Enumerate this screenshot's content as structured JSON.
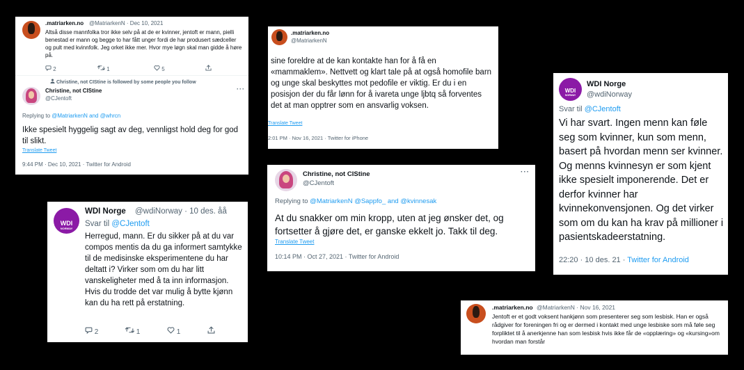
{
  "card1": {
    "name": ".matriarken.no",
    "handle_date": "@MatriarkenN · Dec 10, 2021",
    "text": "Altså disse mannfolka tror ikke selv på at de er kvinner, jentoft er mann, pielli benestad er mann og begge to har fått unger fordi de har produsert sædceller og pult med kvinnfolk. Jeg orket ikke mer. Hvor mye løgn skal man gidde å høre på.",
    "reply_count": "2",
    "retweet_count": "1",
    "like_count": "5",
    "follow_note": "Christine, not CIStine is followed by some people you follow",
    "reply_name": "Christine, not CIStine",
    "reply_handle": "@CJentoft",
    "replying_prefix": "Replying to ",
    "replying_to": "@MatriarkenN and @whrcn",
    "reply_text": "Ikke spesielt hyggelig sagt av deg, vennligst hold deg for god til slikt.",
    "translate": "Translate Tweet",
    "meta": "9:44 PM · Dec 10, 2021 · Twitter for Android"
  },
  "card2": {
    "name": ".matriarken.no",
    "handle": "@MatriarkenN",
    "text": "sine foreldre at de kan kontakte han for å få en «mammaklem». Nettvett og klart tale på at også homofile barn og unge skal beskyttes mot pedofile er viktig. Er du i en posisjon der du får lønn for å ivareta unge ljbtq så forventes det at man opptrer som en ansvarlig voksen.",
    "translate": "Translate Tweet",
    "meta": "2:01 PM · Nov 16, 2021 · Twitter for iPhone"
  },
  "card3": {
    "logo": "WDI",
    "logo_sub": "NORWAY",
    "name": "WDI Norge",
    "handle": "@wdiNorway",
    "reply_prefix": "Svar til ",
    "reply_to": "@CJentoft",
    "text": "Vi har svart. Ingen menn kan føle seg som kvinner, kun som menn, basert på hvordan menn ser kvinner. Og menns kvinnesyn er som kjent ikke spesielt imponerende. Det er derfor kvinner har kvinnekonvensjonen. Og det virker som om du kan ha krav på millioner i pasientskadeerstatning.",
    "time": "22:20 · 10 des. 21 · ",
    "client": "Twitter for Android"
  },
  "card4": {
    "logo": "WDI",
    "logo_sub": "NORWAY",
    "name": "WDI Norge",
    "handle_date": "@wdiNorway · 10 des. åå",
    "reply_prefix": "Svar til ",
    "reply_to": "@CJentoft",
    "text": "Herregud, mann. Er du sikker på at du var compos mentis da du ga informert samtykke til de medisinske eksperimentene du har deltatt i? Virker som om du har litt vanskeligheter med å ta inn informasjon. Hvis du trodde det var mulig å bytte kjønn kan du ha rett på erstatning.",
    "reply_count": "2",
    "retweet_count": "1",
    "like_count": "1"
  },
  "card5": {
    "name": "Christine, not CIStine",
    "handle": "@CJentoft",
    "replying_prefix": "Replying to ",
    "replying_to": "@MatriarkenN @Sappfo_ and @kvinnesak",
    "text": "At du snakker om min kropp, uten at jeg ønsker det, og fortsetter å gjøre det, er ganske ekkelt jo. Takk til deg.",
    "translate": "Translate Tweet",
    "meta": "10:14 PM · Oct 27, 2021 · Twitter for Android"
  },
  "card6": {
    "name": ".matriarken.no",
    "handle_date": "@MatriarkenN · Nov 16, 2021",
    "text": "Jentoft er et godt voksent hankjønn som presenterer seg som lesbisk. Han er også rådgiver for foreningen fri og er dermed i kontakt med unge lesbiske som må føle seg forpliktet til å anerkjenne han som lesbisk hvis ikke får de «opplæring» og «kursing»om hvordan man forstår"
  },
  "icons": [
    "reply-icon",
    "retweet-icon",
    "like-icon",
    "share-icon",
    "person-icon",
    "more-icon"
  ],
  "colors": {
    "link": "#1d9bf0",
    "muted": "#536471",
    "wdi_purple": "#8b1aa6",
    "background": "#000000"
  }
}
